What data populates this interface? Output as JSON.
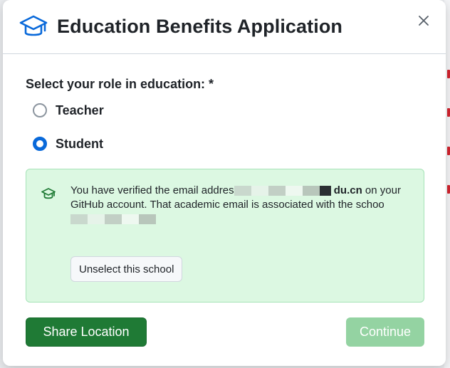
{
  "dialog": {
    "title": "Education Benefits Application",
    "close_label": "×"
  },
  "form": {
    "role_label": "Select your role in education: *",
    "roles": [
      {
        "label": "Teacher",
        "checked": false
      },
      {
        "label": "Student",
        "checked": true
      }
    ]
  },
  "school_box": {
    "text_part1": "You have verified the email addres",
    "text_domain": "du.cn",
    "text_part2": " on your GitHub account. That academic email is associated with the schoo",
    "unselect_label": "Unselect this school"
  },
  "footer": {
    "share_label": "Share Location",
    "continue_label": "Continue"
  },
  "colors": {
    "primary_green": "#1f7a35",
    "disabled_green": "#94d3a2",
    "radio_blue": "#0969da",
    "info_bg": "#dcf8e2"
  },
  "icons": {
    "header": "graduation-cap-icon",
    "school": "graduation-cap-icon",
    "close": "close-icon"
  }
}
